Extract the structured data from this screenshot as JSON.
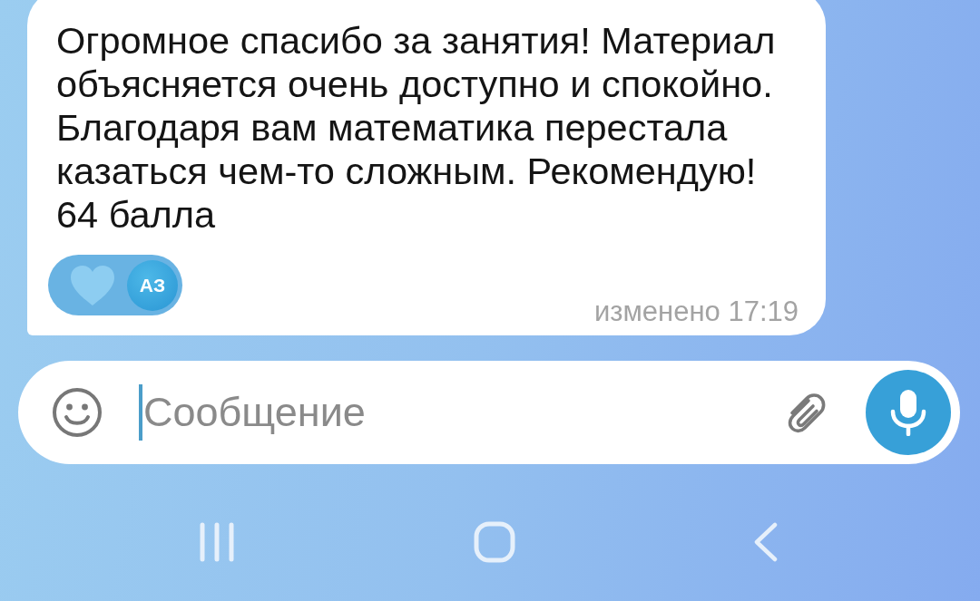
{
  "message": {
    "text": "Огромное спасибо за занятия! Материал объясняется очень доступно и спокойно. Благодаря вам математика перестала казаться чем-то сложным. Рекомендую!\n64 балла",
    "reactions": [
      {
        "initials": "АЗ"
      }
    ],
    "status": "изменено 17:19"
  },
  "composer": {
    "placeholder": "Сообщение",
    "focused": true
  },
  "nav_bar": {
    "buttons": [
      {
        "kind": "recents"
      },
      {
        "kind": "home"
      },
      {
        "kind": "back"
      }
    ]
  }
}
